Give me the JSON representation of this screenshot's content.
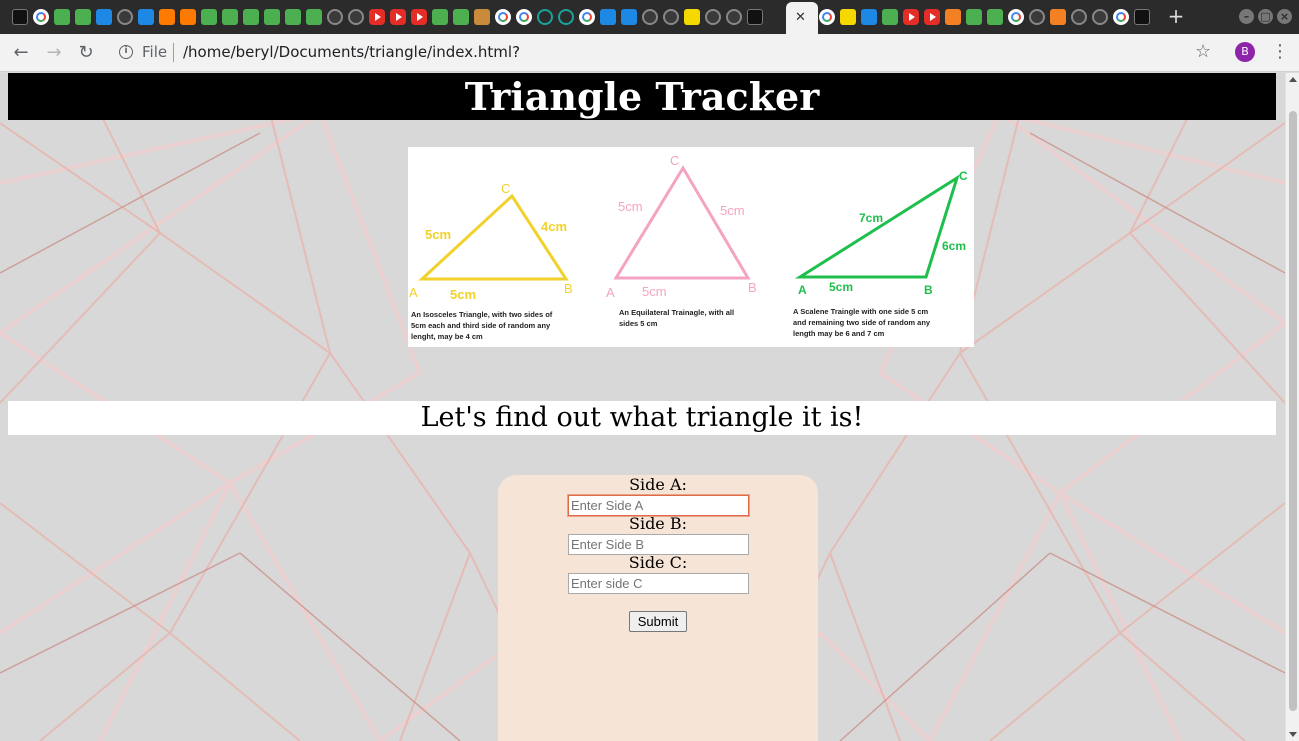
{
  "browser": {
    "tab_favicons": [
      "ghost",
      "google",
      "w3",
      "w3",
      "question",
      "github",
      "cw",
      "cs",
      "cs",
      "chrome-green",
      "w3",
      "w3",
      "w3",
      "w3",
      "w3",
      "github",
      "github",
      "youtube",
      "youtube",
      "youtube",
      "w3",
      "w3",
      "wiki",
      "google",
      "google",
      "ring",
      "ring",
      "google",
      "cw",
      "cw",
      "github",
      "github",
      "warning",
      "github",
      "github",
      "dark"
    ],
    "tab_favicons_right": [
      "google",
      "yellow",
      "cw",
      "w3",
      "youtube",
      "youtube",
      "stackoverflow",
      "w3",
      "w3",
      "google",
      "github",
      "stackoverflow",
      "github",
      "github",
      "google",
      "penguin"
    ],
    "active_tab_close": "✕",
    "new_tab": "+",
    "url_scheme": "File",
    "url": "/home/beryl/Documents/triangle/index.html?",
    "profile_initial": "B"
  },
  "page": {
    "title": "Triangle Tracker",
    "subheading": "Let's find out what triangle it is!",
    "illustration": {
      "isosceles": {
        "vertices": [
          "A",
          "B",
          "C"
        ],
        "sides": [
          "5cm",
          "4cm",
          "5cm"
        ],
        "caption": [
          "An Isosceles Triangle, with two sides of",
          "5cm each and third side of random any",
          "lenght, may be 4 cm"
        ],
        "color": "#f2d12a"
      },
      "equilateral": {
        "vertices": [
          "A",
          "B",
          "C"
        ],
        "sides": [
          "5cm",
          "5cm",
          "5cm"
        ],
        "caption": [
          "An Equilateral Trainagle, with all",
          "sides 5 cm"
        ],
        "color": "#f5a3c2"
      },
      "scalene": {
        "vertices": [
          "A",
          "B",
          "C"
        ],
        "sides": [
          "7cm",
          "6cm",
          "5cm"
        ],
        "caption": [
          "A Scalene Traingle with one side 5 cm",
          "and remaining two side of random any",
          "length may be 6 and 7 cm"
        ],
        "color": "#1fbf4e"
      }
    },
    "form": {
      "side_a_label": "Side A:",
      "side_a_placeholder": "Enter Side A",
      "side_b_label": "Side B:",
      "side_b_placeholder": "Enter Side B",
      "side_c_label": "Side C:",
      "side_c_placeholder": "Enter side C",
      "submit_label": "Submit"
    }
  }
}
